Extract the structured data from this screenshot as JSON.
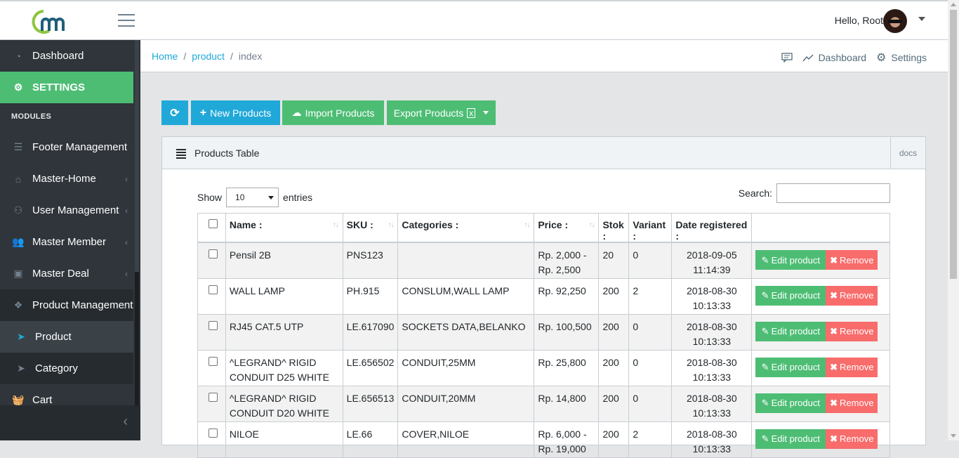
{
  "header": {
    "greeting": "Hello, Root"
  },
  "sidebar": {
    "dashboard": "Dashboard",
    "settings": "SETTINGS",
    "modules_title": "MODULES",
    "items": [
      {
        "label": "Footer Management"
      },
      {
        "label": "Master-Home"
      },
      {
        "label": "User Management"
      },
      {
        "label": "Master Member"
      },
      {
        "label": "Master Deal"
      },
      {
        "label": "Product Management"
      },
      {
        "label": "Product"
      },
      {
        "label": "Category"
      },
      {
        "label": "Cart"
      }
    ]
  },
  "breadcrumb": {
    "home": "Home",
    "product": "product",
    "current": "index",
    "menu_dashboard": "Dashboard",
    "menu_settings": "Settings"
  },
  "toolbar": {
    "new": "New Products",
    "import": "Import Products",
    "export": "Export Products"
  },
  "card": {
    "title": "Products Table",
    "docs": "docs"
  },
  "table_controls": {
    "show": "Show",
    "entries_value": "10",
    "entries": "entries",
    "search": "Search:"
  },
  "table": {
    "headers": [
      "Name :",
      "SKU :",
      "Categories :",
      "Price :",
      "Stok :",
      "Variant :",
      "Date registered :"
    ],
    "edit_label": "Edit product",
    "remove_label": "Remove",
    "rows": [
      {
        "name": "Pensil 2B",
        "sku": "PNS123",
        "categories": "",
        "price": "Rp. 2,000 - Rp. 2,500",
        "stok": "20",
        "variant": "0",
        "date": "2018-09-05 11:14:39"
      },
      {
        "name": "WALL LAMP",
        "sku": "PH.915",
        "categories": "CONSLUM,WALL LAMP",
        "price": "Rp. 92,250",
        "stok": "200",
        "variant": "2",
        "date": "2018-08-30 10:13:33"
      },
      {
        "name": "RJ45 CAT.5 UTP",
        "sku": "LE.617090",
        "categories": "SOCKETS DATA,BELANKO",
        "price": "Rp. 100,500",
        "stok": "200",
        "variant": "0",
        "date": "2018-08-30 10:13:33"
      },
      {
        "name": "^LEGRAND^ RIGID CONDUIT D25 WHITE",
        "sku": "LE.656502",
        "categories": "CONDUIT,25MM",
        "price": "Rp. 25,800",
        "stok": "200",
        "variant": "0",
        "date": "2018-08-30 10:13:33"
      },
      {
        "name": "^LEGRAND^ RIGID CONDUIT D20 WHITE",
        "sku": "LE.656513",
        "categories": "CONDUIT,20MM",
        "price": "Rp. 14,800",
        "stok": "200",
        "variant": "0",
        "date": "2018-08-30 10:13:33"
      },
      {
        "name": "NILOE",
        "sku": "LE.66",
        "categories": "COVER,NILOE",
        "price": "Rp. 6,000 - Rp. 19,000",
        "stok": "200",
        "variant": "2",
        "date": "2018-08-30 10:13:33"
      }
    ]
  },
  "colors": {
    "primary": "#20a8d8",
    "success": "#4dbd74",
    "danger": "#f86c6b",
    "sidebar": "#2f353a"
  }
}
